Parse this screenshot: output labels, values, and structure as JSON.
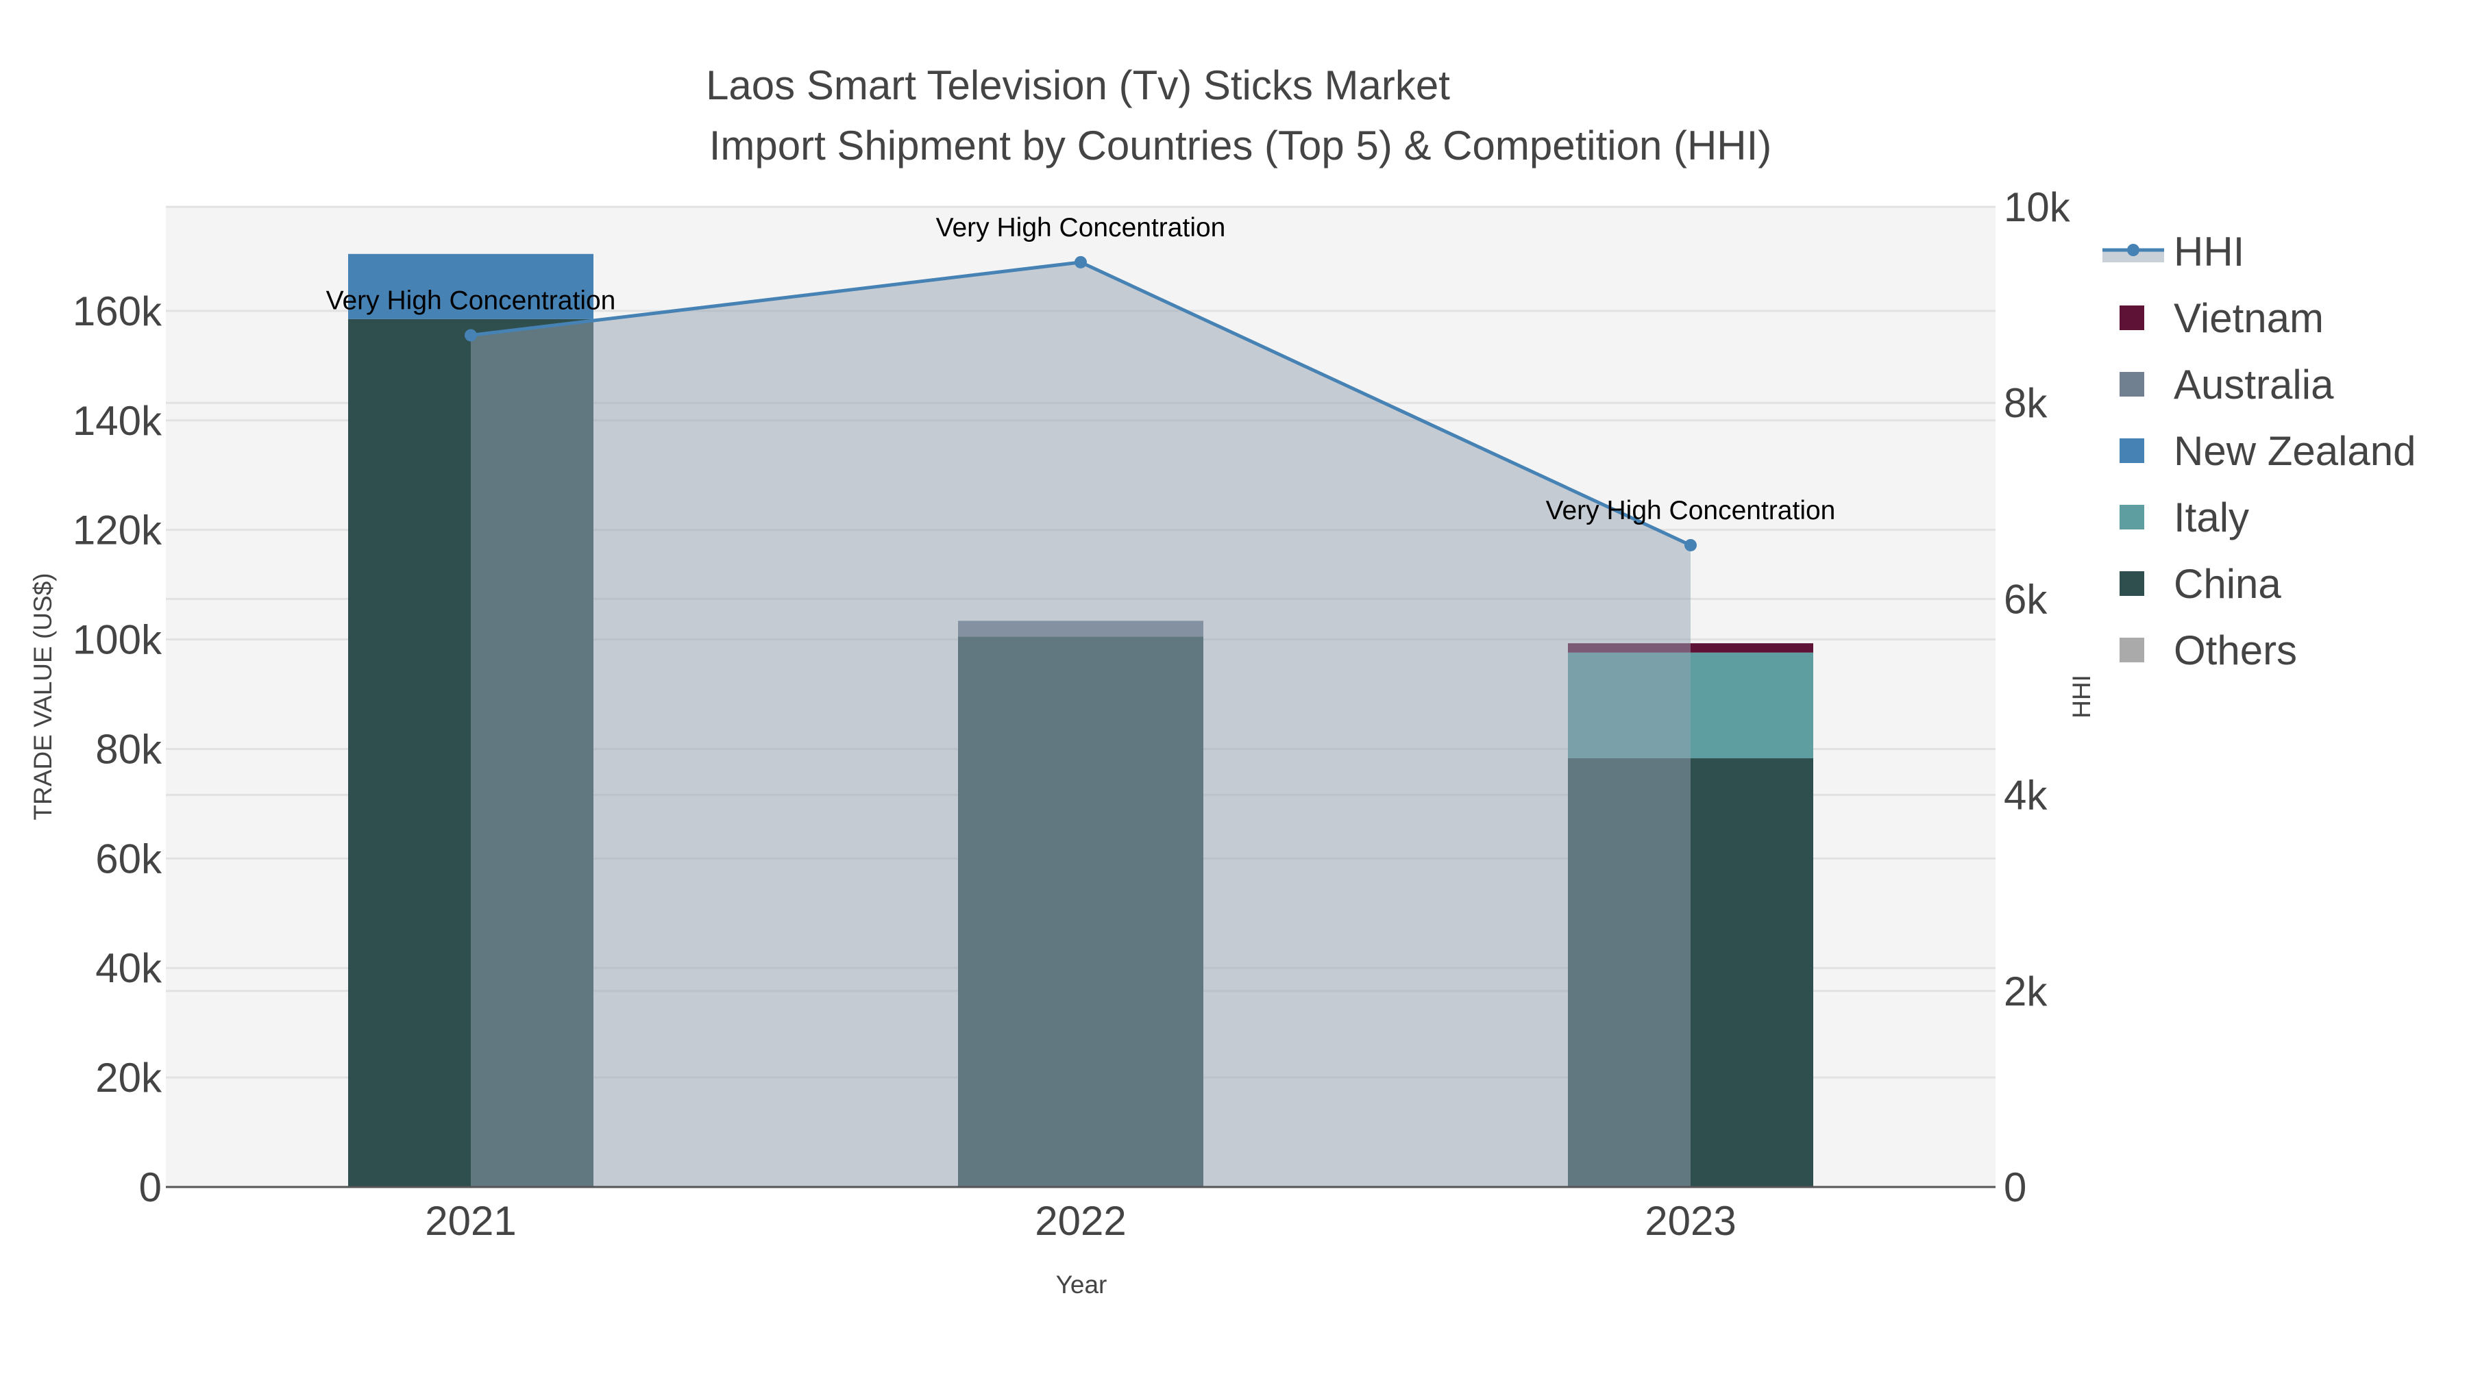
{
  "chart_data": {
    "type": "bar",
    "title": "Laos Smart Television (Tv) Sticks Market",
    "subtitle": "Import Shipment by Countries (Top 5) & Competition (HHI)",
    "xlabel": "Year",
    "ylabel": "TRADE VALUE (US$)",
    "y2label": "HHI",
    "categories": [
      "2021",
      "2022",
      "2023"
    ],
    "ylim": [
      0,
      179000
    ],
    "y2lim": [
      0,
      10000
    ],
    "yticks": [
      0,
      20000,
      40000,
      60000,
      80000,
      100000,
      120000,
      140000,
      160000
    ],
    "ytick_labels": [
      "0",
      "20k",
      "40k",
      "60k",
      "80k",
      "100k",
      "120k",
      "140k",
      "160k"
    ],
    "y2ticks": [
      0,
      2000,
      4000,
      6000,
      8000,
      10000
    ],
    "y2tick_labels": [
      "0",
      "2k",
      "4k",
      "6k",
      "8k",
      "10k"
    ],
    "barmode": "stack",
    "series": [
      {
        "name": "China",
        "color": "#2f4f4f",
        "values": [
          158500,
          100500,
          78300
        ]
      },
      {
        "name": "Italy",
        "color": "#5f9ea0",
        "values": [
          0,
          0,
          19300
        ]
      },
      {
        "name": "New Zealand",
        "color": "#4682b4",
        "values": [
          11900,
          0,
          0
        ]
      },
      {
        "name": "Australia",
        "color": "#708090",
        "values": [
          0,
          2900,
          0
        ]
      },
      {
        "name": "Vietnam",
        "color": "#5e1236",
        "values": [
          0,
          0,
          1700
        ]
      },
      {
        "name": "Others",
        "color": "#aaaaaa",
        "values": [
          0,
          0,
          0
        ]
      }
    ],
    "hhi": {
      "name": "HHI",
      "color": "#4682b4",
      "values": [
        8690,
        9435,
        6548
      ],
      "annotations": [
        "Very High Concentration",
        "Very High Concentration",
        "Very High Concentration"
      ]
    },
    "legend_order": [
      "HHI",
      "Vietnam",
      "Australia",
      "New Zealand",
      "Italy",
      "China",
      "Others"
    ],
    "legend_position": "right",
    "grid": true
  }
}
